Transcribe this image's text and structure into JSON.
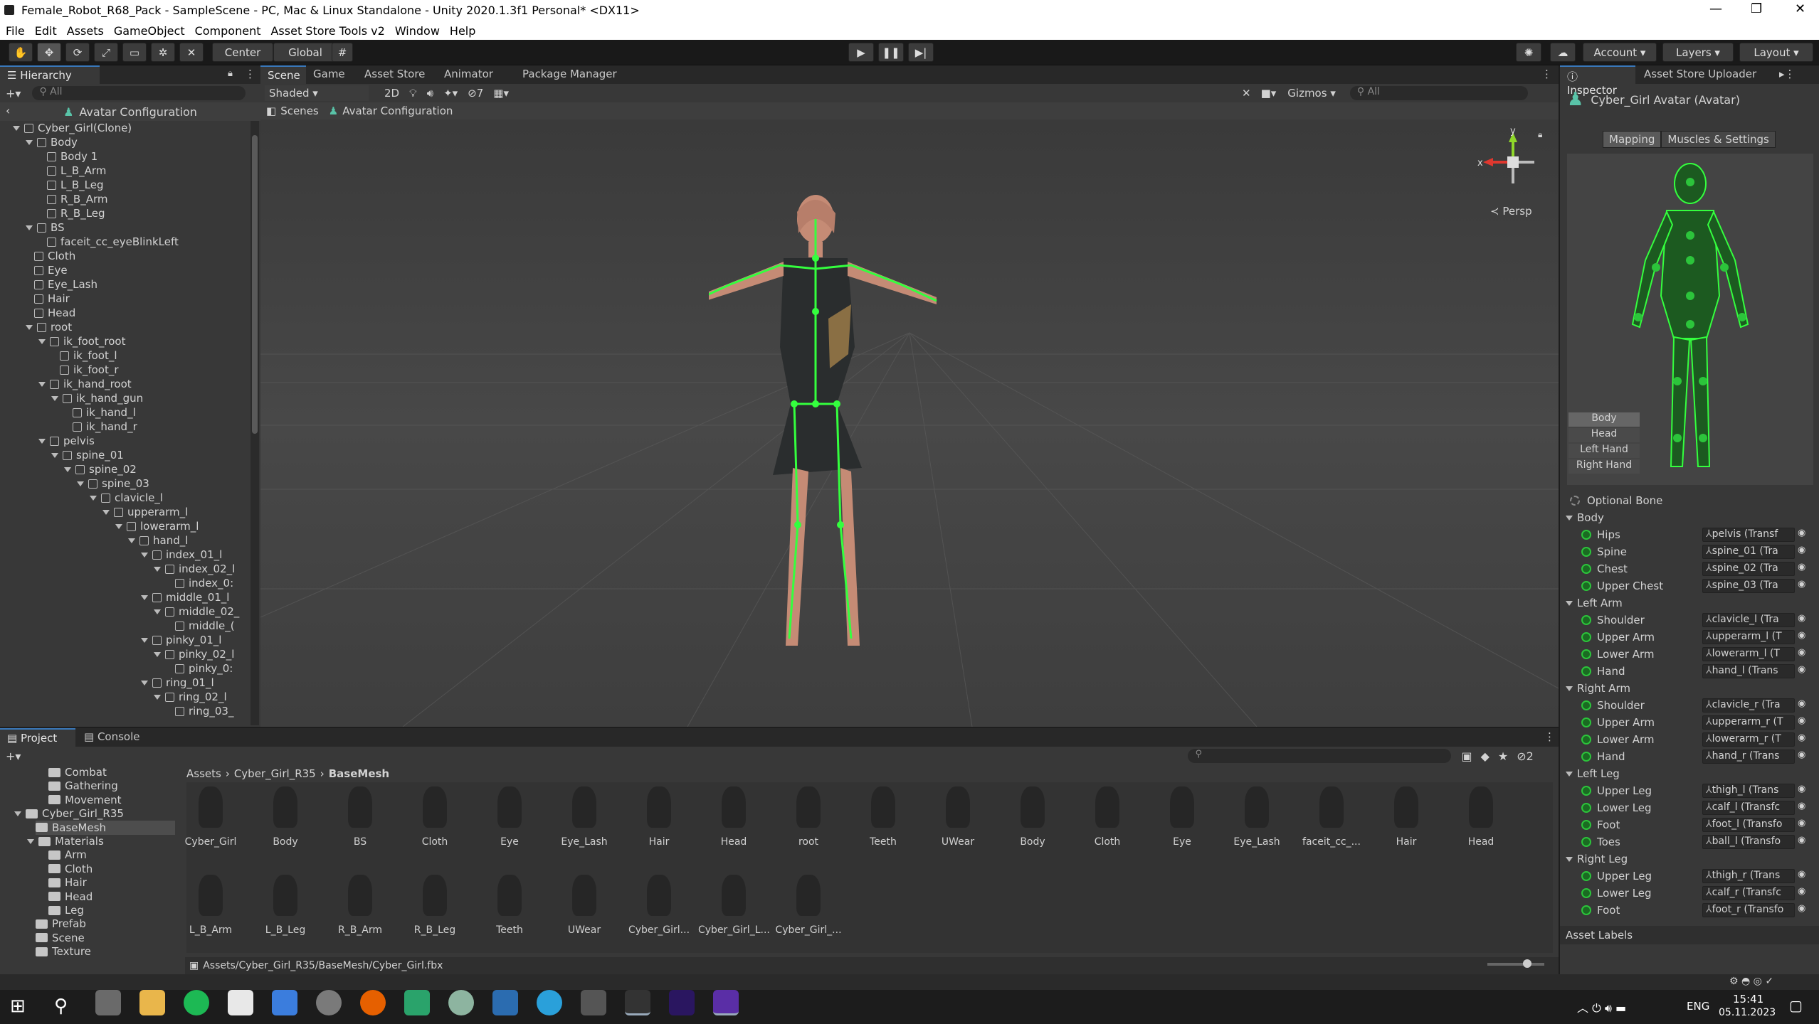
{
  "window": {
    "title": "Female_Robot_R68_Pack - SampleScene - PC, Mac & Linux Standalone - Unity 2020.1.3f1 Personal* <DX11>"
  },
  "menu": [
    "File",
    "Edit",
    "Assets",
    "GameObject",
    "Component",
    "Asset Store Tools v2",
    "Window",
    "Help"
  ],
  "toolbar": {
    "center": "Center",
    "global": "Global",
    "account": "Account",
    "layers": "Layers",
    "layout": "Layout"
  },
  "hierarchy": {
    "tab": "Hierarchy",
    "search_placeholder": "All",
    "header": "Avatar Configuration",
    "items": [
      {
        "label": "Cyber_Girl(Clone)",
        "depth": 0,
        "fold": true
      },
      {
        "label": "Body",
        "depth": 1,
        "fold": true
      },
      {
        "label": "Body 1",
        "depth": 2
      },
      {
        "label": "L_B_Arm",
        "depth": 2
      },
      {
        "label": "L_B_Leg",
        "depth": 2
      },
      {
        "label": "R_B_Arm",
        "depth": 2
      },
      {
        "label": "R_B_Leg",
        "depth": 2
      },
      {
        "label": "BS",
        "depth": 1,
        "fold": true
      },
      {
        "label": "faceit_cc_eyeBlinkLeft",
        "depth": 2
      },
      {
        "label": "Cloth",
        "depth": 1
      },
      {
        "label": "Eye",
        "depth": 1
      },
      {
        "label": "Eye_Lash",
        "depth": 1
      },
      {
        "label": "Hair",
        "depth": 1
      },
      {
        "label": "Head",
        "depth": 1
      },
      {
        "label": "root",
        "depth": 1,
        "fold": true
      },
      {
        "label": "ik_foot_root",
        "depth": 2,
        "fold": true
      },
      {
        "label": "ik_foot_l",
        "depth": 3
      },
      {
        "label": "ik_foot_r",
        "depth": 3
      },
      {
        "label": "ik_hand_root",
        "depth": 2,
        "fold": true
      },
      {
        "label": "ik_hand_gun",
        "depth": 3,
        "fold": true
      },
      {
        "label": "ik_hand_l",
        "depth": 4
      },
      {
        "label": "ik_hand_r",
        "depth": 4
      },
      {
        "label": "pelvis",
        "depth": 2,
        "fold": true
      },
      {
        "label": "spine_01",
        "depth": 3,
        "fold": true
      },
      {
        "label": "spine_02",
        "depth": 4,
        "fold": true
      },
      {
        "label": "spine_03",
        "depth": 5,
        "fold": true
      },
      {
        "label": "clavicle_l",
        "depth": 6,
        "fold": true
      },
      {
        "label": "upperarm_l",
        "depth": 7,
        "fold": true
      },
      {
        "label": "lowerarm_l",
        "depth": 8,
        "fold": true
      },
      {
        "label": "hand_l",
        "depth": 9,
        "fold": true
      },
      {
        "label": "index_01_l",
        "depth": 10,
        "fold": true
      },
      {
        "label": "index_02_l",
        "depth": 11,
        "fold": true
      },
      {
        "label": "index_0:",
        "depth": 12
      },
      {
        "label": "middle_01_l",
        "depth": 10,
        "fold": true
      },
      {
        "label": "middle_02_",
        "depth": 11,
        "fold": true
      },
      {
        "label": "middle_(",
        "depth": 12
      },
      {
        "label": "pinky_01_l",
        "depth": 10,
        "fold": true
      },
      {
        "label": "pinky_02_l",
        "depth": 11,
        "fold": true
      },
      {
        "label": "pinky_0:",
        "depth": 12
      },
      {
        "label": "ring_01_l",
        "depth": 10,
        "fold": true
      },
      {
        "label": "ring_02_l",
        "depth": 11,
        "fold": true
      },
      {
        "label": "ring_03_",
        "depth": 12
      }
    ]
  },
  "scene": {
    "tabs": [
      "Scene",
      "Game",
      "Asset Store",
      "Animator",
      "Package Manager"
    ],
    "shading": "Shaded",
    "mode2d": "2D",
    "hidden_count": "7",
    "gizmos": "Gizmos",
    "search_placeholder": "All",
    "breadcrumb_scenes": "Scenes",
    "breadcrumb_current": "Avatar Configuration",
    "persp": "Persp",
    "axis_y": "y",
    "axis_x": "x"
  },
  "inspector": {
    "tabs": [
      "Inspector",
      "Asset Store Uploader"
    ],
    "title": "Cyber_Girl Avatar (Avatar)",
    "mapping": "Mapping",
    "muscles": "Muscles & Settings",
    "view_buttons": [
      "Body",
      "Head",
      "Left Hand",
      "Right Hand"
    ],
    "optional": "Optional Bone",
    "groups": [
      {
        "name": "Body",
        "bones": [
          [
            "Hips",
            "pelvis (Transf"
          ],
          [
            "Spine",
            "spine_01 (Tra"
          ],
          [
            "Chest",
            "spine_02 (Tra"
          ],
          [
            "Upper Chest",
            "spine_03 (Tra"
          ]
        ]
      },
      {
        "name": "Left Arm",
        "bones": [
          [
            "Shoulder",
            "clavicle_l (Tra"
          ],
          [
            "Upper Arm",
            "upperarm_l (T"
          ],
          [
            "Lower Arm",
            "lowerarm_l (T"
          ],
          [
            "Hand",
            "hand_l (Trans"
          ]
        ]
      },
      {
        "name": "Right Arm",
        "bones": [
          [
            "Shoulder",
            "clavicle_r (Tra"
          ],
          [
            "Upper Arm",
            "upperarm_r (T"
          ],
          [
            "Lower Arm",
            "lowerarm_r (T"
          ],
          [
            "Hand",
            "hand_r (Trans"
          ]
        ]
      },
      {
        "name": "Left Leg",
        "bones": [
          [
            "Upper Leg",
            "thigh_l (Trans"
          ],
          [
            "Lower Leg",
            "calf_l (Transfc"
          ],
          [
            "Foot",
            "foot_l (Transfo"
          ],
          [
            "Toes",
            "ball_l (Transfo"
          ]
        ]
      },
      {
        "name": "Right Leg",
        "bones": [
          [
            "Upper Leg",
            "thigh_r (Trans"
          ],
          [
            "Lower Leg",
            "calf_r (Transfc"
          ],
          [
            "Foot",
            "foot_r (Transfo"
          ]
        ]
      }
    ],
    "asset_labels": "Asset Labels"
  },
  "project": {
    "tabs": [
      "Project",
      "Console"
    ],
    "breadcrumb": [
      "Assets",
      "Cyber_Girl_R35",
      "BaseMesh"
    ],
    "hidden_count": "2",
    "tree": [
      {
        "label": "Combat",
        "depth": 3
      },
      {
        "label": "Gathering",
        "depth": 3
      },
      {
        "label": "Movement",
        "depth": 3
      },
      {
        "label": "Cyber_Girl_R35",
        "depth": 1,
        "fold": true
      },
      {
        "label": "BaseMesh",
        "depth": 2,
        "selected": true
      },
      {
        "label": "Materials",
        "depth": 2,
        "fold": true
      },
      {
        "label": "Arm",
        "depth": 3
      },
      {
        "label": "Cloth",
        "depth": 3
      },
      {
        "label": "Hair",
        "depth": 3
      },
      {
        "label": "Head",
        "depth": 3
      },
      {
        "label": "Leg",
        "depth": 3
      },
      {
        "label": "Prefab",
        "depth": 2
      },
      {
        "label": "Scene",
        "depth": 2
      },
      {
        "label": "Texture",
        "depth": 2
      }
    ],
    "assets_row1": [
      "Cyber_Girl",
      "Body",
      "BS",
      "Cloth",
      "Eye",
      "Eye_Lash",
      "Hair",
      "Head",
      "root",
      "Teeth",
      "UWear",
      "Body",
      "Cloth",
      "Eye",
      "Eye_Lash",
      "faceit_cc_...",
      "Hair",
      "Head"
    ],
    "assets_row2": [
      "L_B_Arm",
      "L_B_Leg",
      "R_B_Arm",
      "R_B_Leg",
      "Teeth",
      "UWear",
      "Cyber_Girl...",
      "Cyber_Girl_L...",
      "Cyber_Girl_..."
    ],
    "status_path": "Assets/Cyber_Girl_R35/BaseMesh/Cyber_Girl.fbx"
  },
  "taskbar": {
    "lang": "ENG",
    "time": "15:41",
    "date": "05.11.2023"
  },
  "colors": {
    "accent": "#3a79bb",
    "bone": "#2cc43b"
  }
}
